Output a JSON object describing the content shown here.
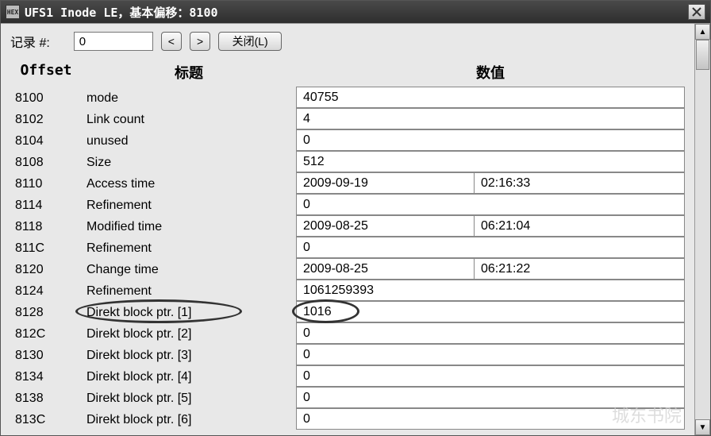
{
  "window": {
    "title": "UFS1 Inode LE，基本偏移：8100"
  },
  "toolbar": {
    "record_label": "记录 #:",
    "record_value": "0",
    "prev_label": "<",
    "next_label": ">",
    "close_label": "关闭(L)"
  },
  "headers": {
    "offset": "Offset",
    "title": "标题",
    "value": "数值"
  },
  "rows": [
    {
      "offset": "8100",
      "title": "mode",
      "value": "40755"
    },
    {
      "offset": "8102",
      "title": "Link count",
      "value": "4"
    },
    {
      "offset": "8104",
      "title": "unused",
      "value": "0"
    },
    {
      "offset": "8108",
      "title": "Size",
      "value": "512"
    },
    {
      "offset": "8110",
      "title": "Access time",
      "value": "2009-09-19",
      "value2": "02:16:33"
    },
    {
      "offset": "8114",
      "title": "Refinement",
      "value": "0"
    },
    {
      "offset": "8118",
      "title": "Modified time",
      "value": "2009-08-25",
      "value2": "06:21:04"
    },
    {
      "offset": "811C",
      "title": "Refinement",
      "value": "0"
    },
    {
      "offset": "8120",
      "title": "Change time",
      "value": "2009-08-25",
      "value2": "06:21:22"
    },
    {
      "offset": "8124",
      "title": "Refinement",
      "value": "1061259393"
    },
    {
      "offset": "8128",
      "title": "Direkt block ptr. [1]",
      "value": "1016",
      "highlight": true
    },
    {
      "offset": "812C",
      "title": "Direkt block ptr. [2]",
      "value": "0"
    },
    {
      "offset": "8130",
      "title": "Direkt block ptr. [3]",
      "value": "0"
    },
    {
      "offset": "8134",
      "title": "Direkt block ptr. [4]",
      "value": "0"
    },
    {
      "offset": "8138",
      "title": "Direkt block ptr. [5]",
      "value": "0"
    },
    {
      "offset": "813C",
      "title": "Direkt block ptr. [6]",
      "value": "0"
    }
  ],
  "watermark": "城东书院"
}
